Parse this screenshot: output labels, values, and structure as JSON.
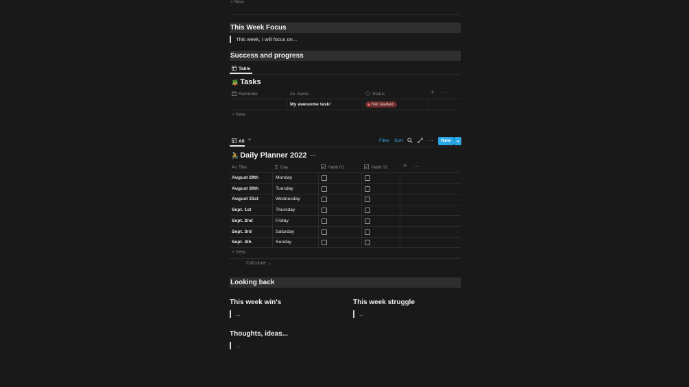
{
  "top_new": "+ New",
  "focus": {
    "title": "This Week Focus",
    "quote": "This week, I will focus on..."
  },
  "progress": {
    "title": "Success and progress",
    "view_tab": "Table",
    "db_emoji": "🪴",
    "db_title": "Tasks",
    "columns": [
      "Reminder",
      "Name",
      "Status"
    ],
    "row": {
      "name": "My awesome task!",
      "status": "Not started"
    },
    "new_label": "New"
  },
  "planner": {
    "view_tab": "All",
    "filter": "Filter",
    "sort": "Sort",
    "new_button": "New",
    "db_emoji": "🚴",
    "db_title": "Daily Planner 2022",
    "columns": [
      "Title",
      "Day",
      "Habit 01",
      "Habit 02"
    ],
    "rows": [
      {
        "title": "August 29th",
        "day": "Monday"
      },
      {
        "title": "August 30th",
        "day": "Tuesday"
      },
      {
        "title": "August 31st",
        "day": "Wednesday"
      },
      {
        "title": "Sept. 1st",
        "day": "Thursday"
      },
      {
        "title": "Sept. 2nd",
        "day": "Friday"
      },
      {
        "title": "Sept. 3rd",
        "day": "Saturday"
      },
      {
        "title": "Sept. 4th",
        "day": "Sunday"
      }
    ],
    "new_label": "New",
    "calculate": "Calculate"
  },
  "looking_back": {
    "title": "Looking back",
    "wins_title": "This week win's",
    "wins_text": "...",
    "struggle_title": "This week struggle",
    "struggle_text": "...",
    "thoughts_title": "Thoughts, ideas...",
    "thoughts_text": "..."
  },
  "colors": {
    "accent": "#2aa7e6",
    "badge_bg": "#6b2b2b",
    "bar_bg": "#2f2f2f"
  }
}
